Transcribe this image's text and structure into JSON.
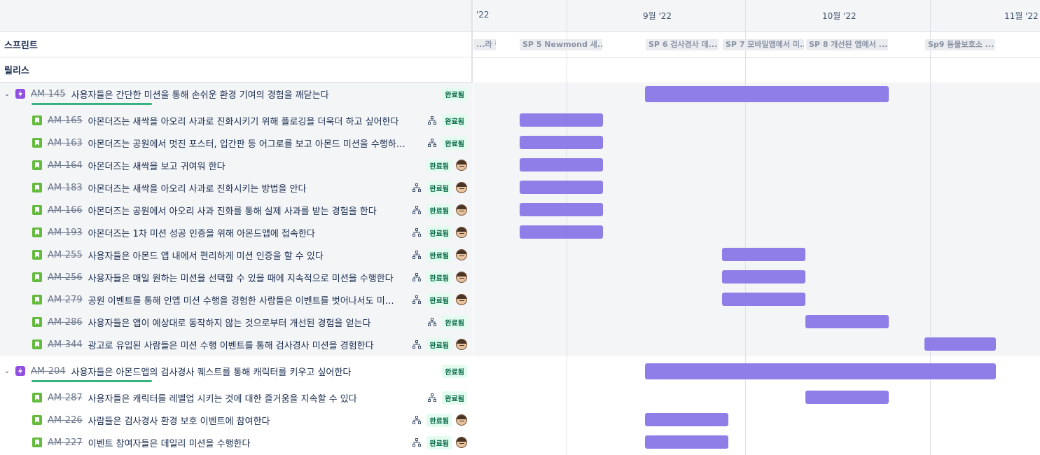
{
  "header": {
    "sprint_label": "스프린트",
    "release_label": "릴리스"
  },
  "months": [
    "'22",
    "9월 '22",
    "10월 '22",
    "11월 '22"
  ],
  "sprints": [
    "...라 링...",
    "SP 5 Newmond 새...",
    "SP 6 검사경사 데...",
    "SP 7 모바일앱에서 미...",
    "SP 8 개선된 앱에서 ...",
    "Sp9 동물보호소 ..."
  ],
  "status_done": "완료됨",
  "epics": [
    {
      "key": "AM-145",
      "summary": "사용자들은 간단한 미션을 통해 손쉬운 환경 기여의 경험을 깨닫는다",
      "status": "완료됨",
      "children": [
        {
          "key": "AM-165",
          "summary": "아몬더즈는 새싹을 아오리 사과로 진화시키기 위해 플로깅을 더욱더 하고 싶어한다",
          "status": "완료됨",
          "has_children": true,
          "avatar": false
        },
        {
          "key": "AM-163",
          "summary": "아몬더즈는 공원에서 멋진 포스터, 입간판 등 어그로를 보고 아몬드 미션을 수행하고 싶...",
          "status": "완료됨",
          "has_children": true,
          "avatar": false
        },
        {
          "key": "AM-164",
          "summary": "아몬더즈는 새싹을 보고 귀여워 한다",
          "status": "완료됨",
          "has_children": false,
          "avatar": true
        },
        {
          "key": "AM-183",
          "summary": "아몬더즈는 새싹을 아오리 사과로 진화시키는 방법을 안다",
          "status": "완료됨",
          "has_children": true,
          "avatar": true
        },
        {
          "key": "AM-166",
          "summary": "아몬더즈는 공원에서 아오리 사과 진화를 통해 실제 사과를 받는 경험을 한다",
          "status": "완료됨",
          "has_children": true,
          "avatar": true
        },
        {
          "key": "AM-193",
          "summary": "아몬더즈는 1차 미션 성공 인증을 위해 아몬드앱에 접속한다",
          "status": "완료됨",
          "has_children": true,
          "avatar": true
        },
        {
          "key": "AM-255",
          "summary": "사용자들은 아몬드 앱 내에서 편리하게 미션 인증을 할 수 있다",
          "status": "완료됨",
          "has_children": true,
          "avatar": true
        },
        {
          "key": "AM-256",
          "summary": "사용자들은 매일 원하는 미션을 선택할 수 있을 때에 지속적으로 미션을 수행한다",
          "status": "완료됨",
          "has_children": true,
          "avatar": true
        },
        {
          "key": "AM-279",
          "summary": "공원 이벤트를 통해 인앱 미션 수행을 경험한 사람들은 이벤트를 벗어나서도 미션...",
          "status": "완료됨",
          "has_children": true,
          "avatar": true
        },
        {
          "key": "AM-286",
          "summary": "사용자들은 앱이 예상대로 동작하지 않는 것으로부터 개선된 경험을 얻는다",
          "status": "완료됨",
          "has_children": true,
          "avatar": false
        },
        {
          "key": "AM-344",
          "summary": "광고로 유입된 사람들은 미션 수행 이벤트를 통해 검사경사 미션을 경험한다",
          "status": "완료됨",
          "has_children": true,
          "avatar": true
        }
      ]
    },
    {
      "key": "AM-204",
      "summary": "사용자들은 아몬드앱의 검사경사 퀘스트를 통해 캐릭터를 키우고 싶어한다",
      "status": "완료됨",
      "children": [
        {
          "key": "AM-287",
          "summary": "사용자들은 캐릭터를 레벨업 시키는 것에 대한 즐거움을 지속할 수 있다",
          "status": "완료됨",
          "has_children": true,
          "avatar": false
        },
        {
          "key": "AM-226",
          "summary": "사람들은 검사경사 환경 보호 이벤트에 참여한다",
          "status": "완료됨",
          "has_children": true,
          "avatar": true
        },
        {
          "key": "AM-227",
          "summary": "이벤트 참여자들은 데일리 미션을 수행한다",
          "status": "완료됨",
          "has_children": true,
          "avatar": true
        }
      ]
    }
  ],
  "colors": {
    "bar": "#8f7ee7",
    "epic_icon": "#904ee2",
    "story_icon": "#63ba3c",
    "done_text": "#006644",
    "done_bg": "#e3fcef",
    "progress": "#36b37e"
  }
}
